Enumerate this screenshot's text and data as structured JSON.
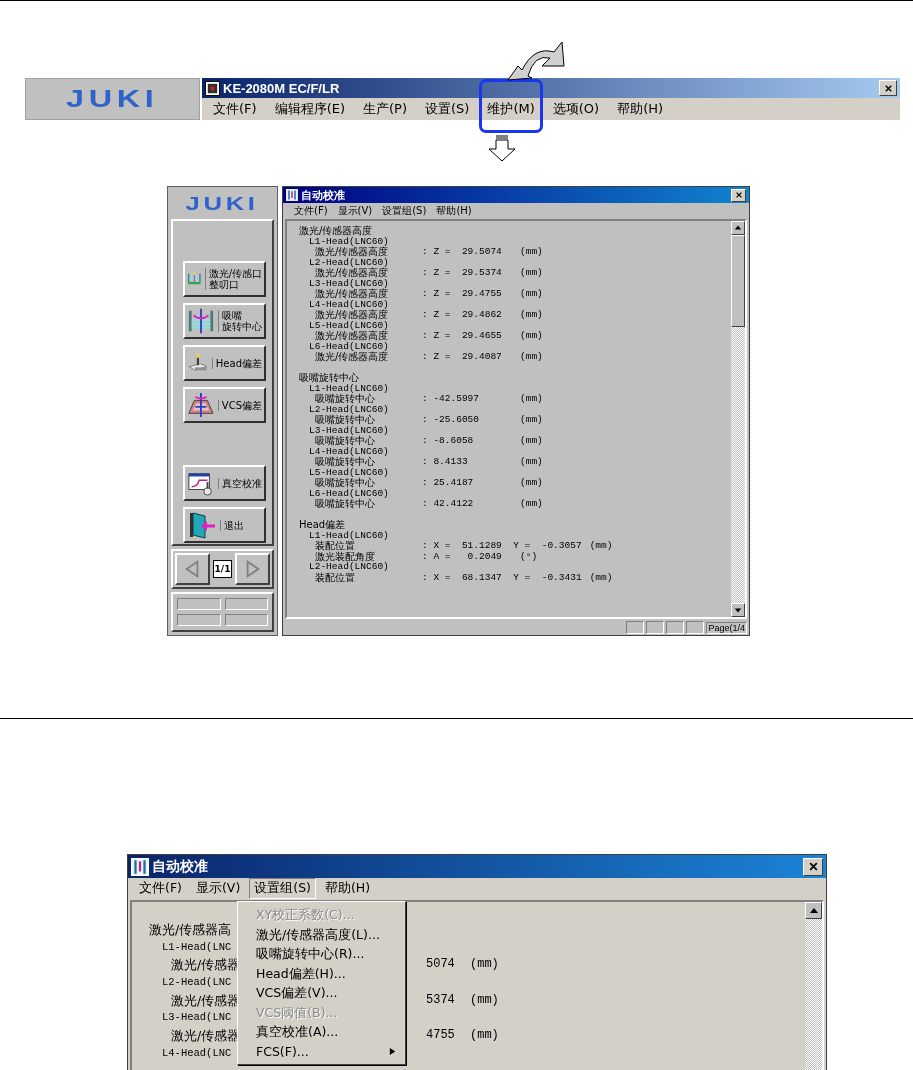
{
  "top_screenshot": {
    "logo": "JUKI",
    "window": {
      "title": "KE-2080M EC/F/LR",
      "menu": [
        {
          "label": "文件(F)",
          "highlighted": false
        },
        {
          "label": "编辑程序(E)",
          "highlighted": false
        },
        {
          "label": "生产(P)",
          "highlighted": false
        },
        {
          "label": "设置(S)",
          "highlighted": false
        },
        {
          "label": "维护(M)",
          "highlighted": true
        },
        {
          "label": "选项(O)",
          "highlighted": false
        },
        {
          "label": "帮助(H)",
          "highlighted": false
        }
      ]
    }
  },
  "middle_screenshot": {
    "logo": "JUKI",
    "button_groups": [
      [
        {
          "kind": "laser",
          "lines": [
            "激光/传感口",
            "整叨口"
          ]
        },
        {
          "kind": "nozzle",
          "lines": [
            "吸嘴",
            "旋转中心"
          ]
        },
        {
          "kind": "head",
          "lines": [
            "Head偏差"
          ]
        },
        {
          "kind": "vcs",
          "lines": [
            "VCS偏差"
          ]
        }
      ],
      [
        {
          "kind": "vacuum",
          "lines": [
            "真空校准"
          ]
        },
        {
          "kind": "exit",
          "lines": [
            "退出"
          ]
        }
      ]
    ],
    "pager": {
      "page": "1/1"
    },
    "window": {
      "title": "自动校准",
      "menu": [
        "文件(F)",
        "显示(V)",
        "设置组(S)",
        "帮助(H)"
      ],
      "lines": [
        {
          "kind": "section",
          "label": "激光/传感器高度"
        },
        {
          "kind": "head",
          "label": "L1-Head(LNC60)"
        },
        {
          "kind": "value",
          "label": "激光/传感器高度",
          "value": ": Z =  29.5074",
          "unit": "(mm)"
        },
        {
          "kind": "head",
          "label": "L2-Head(LNC60)"
        },
        {
          "kind": "value",
          "label": "激光/传感器高度",
          "value": ": Z =  29.5374",
          "unit": "(mm)"
        },
        {
          "kind": "head",
          "label": "L3-Head(LNC60)"
        },
        {
          "kind": "value",
          "label": "激光/传感器高度",
          "value": ": Z =  29.4755",
          "unit": "(mm)"
        },
        {
          "kind": "head",
          "label": "L4-Head(LNC60)"
        },
        {
          "kind": "value",
          "label": "激光/传感器高度",
          "value": ": Z =  29.4862",
          "unit": "(mm)"
        },
        {
          "kind": "head",
          "label": "L5-Head(LNC60)"
        },
        {
          "kind": "value",
          "label": "激光/传感器高度",
          "value": ": Z =  29.4655",
          "unit": "(mm)"
        },
        {
          "kind": "head",
          "label": "L6-Head(LNC60)"
        },
        {
          "kind": "value",
          "label": "激光/传感器高度",
          "value": ": Z =  29.4087",
          "unit": "(mm)"
        },
        {
          "kind": "section",
          "label": "吸嘴旋转中心"
        },
        {
          "kind": "head",
          "label": "L1-Head(LNC60)"
        },
        {
          "kind": "value",
          "label": "吸嘴旋转中心",
          "value": ": -42.5997",
          "unit": "(mm)"
        },
        {
          "kind": "head",
          "label": "L2-Head(LNC60)"
        },
        {
          "kind": "value",
          "label": "吸嘴旋转中心",
          "value": ": -25.6050",
          "unit": "(mm)"
        },
        {
          "kind": "head",
          "label": "L3-Head(LNC60)"
        },
        {
          "kind": "value",
          "label": "吸嘴旋转中心",
          "value": ": -8.6058",
          "unit": "(mm)"
        },
        {
          "kind": "head",
          "label": "L4-Head(LNC60)"
        },
        {
          "kind": "value",
          "label": "吸嘴旋转中心",
          "value": ": 8.4133",
          "unit": "(mm)"
        },
        {
          "kind": "head",
          "label": "L5-Head(LNC60)"
        },
        {
          "kind": "value",
          "label": "吸嘴旋转中心",
          "value": ": 25.4187",
          "unit": "(mm)"
        },
        {
          "kind": "head",
          "label": "L6-Head(LNC60)"
        },
        {
          "kind": "value",
          "label": "吸嘴旋转中心",
          "value": ": 42.4122",
          "unit": "(mm)"
        },
        {
          "kind": "section",
          "label": "Head偏差"
        },
        {
          "kind": "head",
          "label": "L1-Head(LNC60)"
        },
        {
          "kind": "value",
          "label": "装配位置",
          "value": ": X =  51.1289  Y =  -0.3057",
          "unit": "(mm)"
        },
        {
          "kind": "value",
          "label": "激光装配角度",
          "value": ": A =   0.2049",
          "unit": "(°)"
        },
        {
          "kind": "head",
          "label": "L2-Head(LNC60)"
        },
        {
          "kind": "value",
          "label": "装配位置",
          "value": ": X =  68.1347  Y =  -0.3431",
          "unit": "(mm)"
        }
      ],
      "status": "Page(1/4"
    }
  },
  "bottom_screenshot": {
    "window": {
      "title": "自动校准",
      "menu": [
        {
          "label": "文件(F)",
          "open": false
        },
        {
          "label": "显示(V)",
          "open": false
        },
        {
          "label": "设置组(S)",
          "open": true
        },
        {
          "label": "帮助(H)",
          "open": false
        }
      ],
      "lines": [
        {
          "kind": "section",
          "label": "激光/传感器高"
        },
        {
          "kind": "head",
          "label": "L1-Head(LNC"
        },
        {
          "kind": "value",
          "label": "激光/传感器",
          "value": "5074",
          "unit": "(mm)"
        },
        {
          "kind": "head",
          "label": "L2-Head(LNC"
        },
        {
          "kind": "value",
          "label": "激光/传感器",
          "value": "5374",
          "unit": "(mm)"
        },
        {
          "kind": "head",
          "label": "L3-Head(LNC"
        },
        {
          "kind": "value",
          "label": "激光/传感器",
          "value": "4755",
          "unit": "(mm)"
        },
        {
          "kind": "head",
          "label": "L4-Head(LNC"
        }
      ],
      "dropdown": [
        {
          "label": "XY校正系数(C)...",
          "disabled": true,
          "submenu": false
        },
        {
          "label": "激光/传感器高度(L)...",
          "disabled": false,
          "submenu": false
        },
        {
          "label": "吸嘴旋转中心(R)...",
          "disabled": false,
          "submenu": false
        },
        {
          "label": "Head偏差(H)...",
          "disabled": false,
          "submenu": false
        },
        {
          "label": "VCS偏差(V)...",
          "disabled": false,
          "submenu": false
        },
        {
          "label": "VCS阈值(B)...",
          "disabled": true,
          "submenu": false
        },
        {
          "label": "真空校准(A)...",
          "disabled": false,
          "submenu": false
        },
        {
          "label": "FCS(F)...",
          "disabled": false,
          "submenu": true
        }
      ]
    }
  }
}
